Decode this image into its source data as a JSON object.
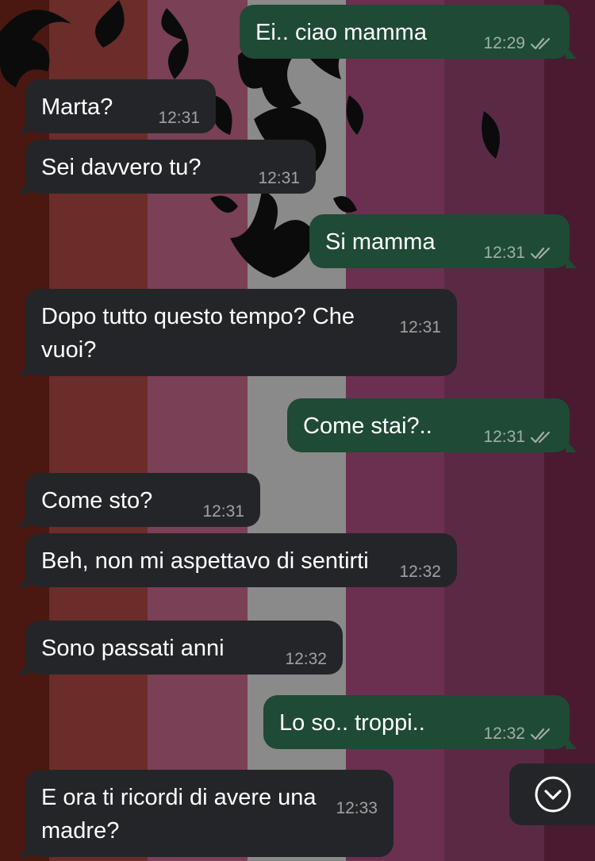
{
  "wallpaper": {
    "stripes": [
      "#4a1810",
      "#6b2d2a",
      "#7a4055",
      "#8a8a8a",
      "#6b3050",
      "#5a2a45",
      "#4a1a30"
    ]
  },
  "messages": [
    {
      "direction": "out",
      "text": "Ei.. ciao mamma",
      "time": "12:29",
      "status": "read"
    },
    {
      "direction": "in",
      "text": "Marta?",
      "time": "12:31"
    },
    {
      "direction": "in",
      "text": "Sei davvero tu?",
      "time": "12:31"
    },
    {
      "direction": "out",
      "text": "Si mamma",
      "time": "12:31",
      "status": "read"
    },
    {
      "direction": "in",
      "text": "Dopo tutto questo tempo? Che vuoi?",
      "time": "12:31"
    },
    {
      "direction": "out",
      "text": "Come stai?..",
      "time": "12:31",
      "status": "read"
    },
    {
      "direction": "in",
      "text": "Come sto?",
      "time": "12:31"
    },
    {
      "direction": "in",
      "text": "Beh, non mi aspettavo di sentirti",
      "time": "12:32"
    },
    {
      "direction": "in",
      "text": "Sono passati anni",
      "time": "12:32"
    },
    {
      "direction": "out",
      "text": "Lo so.. troppi..",
      "time": "12:32",
      "status": "read"
    },
    {
      "direction": "in",
      "text": "E ora ti ricordi di avere una madre?",
      "time": "12:33"
    }
  ],
  "icons": {
    "read_receipt": "double-check-icon",
    "scroll_down": "chevron-down-circle-icon"
  }
}
